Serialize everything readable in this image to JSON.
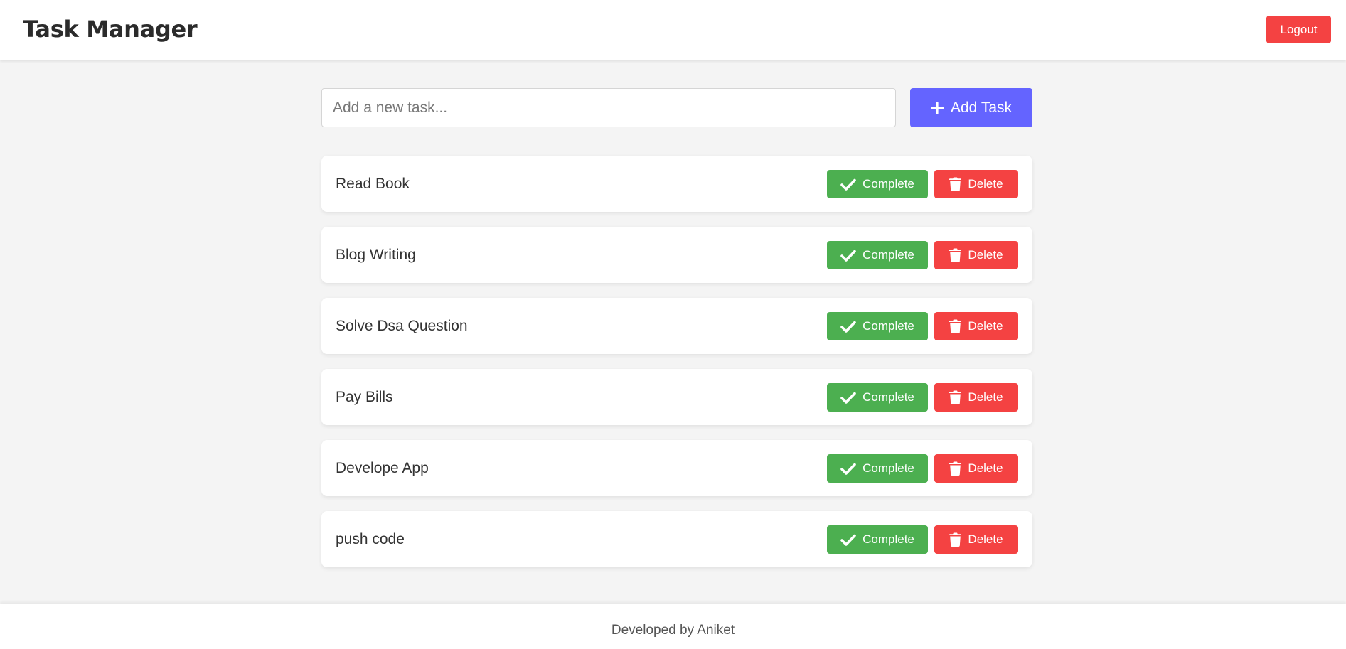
{
  "header": {
    "title": "Task Manager",
    "logout_label": "Logout"
  },
  "add_task": {
    "placeholder": "Add a new task...",
    "value": "",
    "button_label": "Add Task",
    "button_icon": "plus-icon"
  },
  "tasks": [
    {
      "text": "Read Book",
      "complete_label": "Complete",
      "delete_label": "Delete"
    },
    {
      "text": "Blog Writing",
      "complete_label": "Complete",
      "delete_label": "Delete"
    },
    {
      "text": "Solve Dsa Question",
      "complete_label": "Complete",
      "delete_label": "Delete"
    },
    {
      "text": "Pay Bills",
      "complete_label": "Complete",
      "delete_label": "Delete"
    },
    {
      "text": "Develope App",
      "complete_label": "Complete",
      "delete_label": "Delete"
    },
    {
      "text": "push code",
      "complete_label": "Complete",
      "delete_label": "Delete"
    }
  ],
  "icons": {
    "complete": "check-icon",
    "delete": "trash-icon"
  },
  "colors": {
    "primary": "#6464ff",
    "success": "#4caf50",
    "danger": "#f44242",
    "background": "#f4f4f4"
  },
  "footer": {
    "text": "Developed by Aniket"
  }
}
